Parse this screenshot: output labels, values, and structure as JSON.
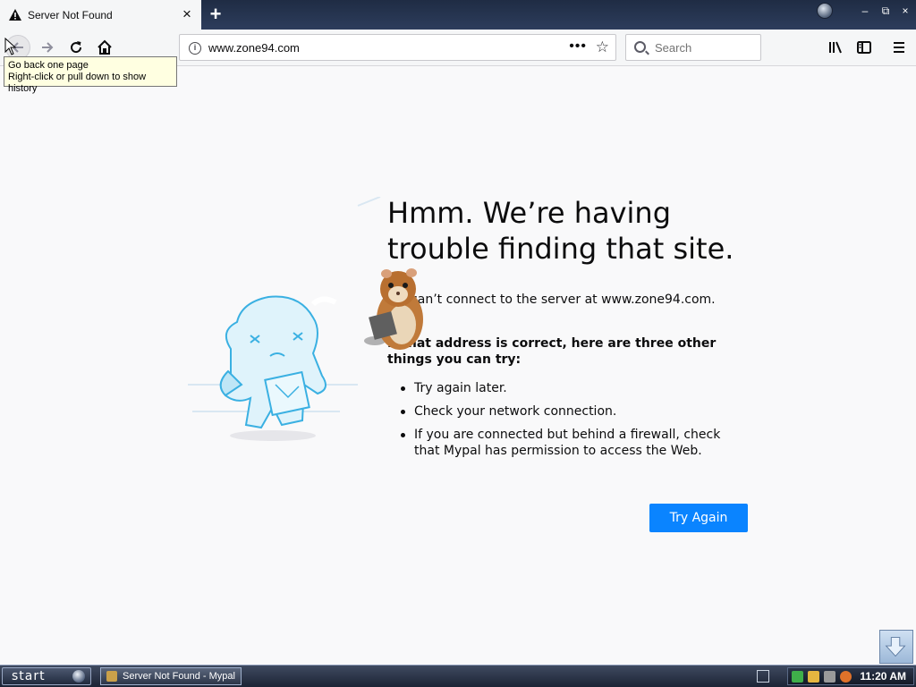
{
  "tab": {
    "title": "Server Not Found",
    "close_label": "×",
    "new_tab_label": "+"
  },
  "window_controls": {
    "minimize": "–",
    "restore": "⧉",
    "close": "×"
  },
  "navbar": {
    "url": "www.zone94.com",
    "page_actions": "•••",
    "search_placeholder": "Search"
  },
  "tooltip": {
    "line1": "Go back one page",
    "line2": "Right-click or pull down to show history"
  },
  "error_page": {
    "title": "Hmm. We’re having trouble finding that site.",
    "description": "We can’t connect to the server at www.zone94.com.",
    "suggestion_heading": "If that address is correct, here are three other things you can try:",
    "suggestions": [
      "Try again later.",
      "Check your network connection.",
      "If you are connected but behind a firewall, check that Mypal has permission to access the Web."
    ],
    "try_again_label": "Try Again"
  },
  "taskbar": {
    "start_label": "start",
    "window_item": "Server Not Found - Mypal",
    "clock": "11:20 AM"
  },
  "colors": {
    "accent": "#0a84ff",
    "tab_strip": "#1f2c44",
    "content_bg": "#f9f9fa"
  },
  "icons": [
    "warning-icon",
    "close-icon",
    "plus-icon",
    "back-arrow-icon",
    "forward-arrow-icon",
    "reload-icon",
    "home-icon",
    "info-icon",
    "star-icon",
    "search-icon",
    "library-icon",
    "sidebar-icon",
    "menu-icon"
  ]
}
